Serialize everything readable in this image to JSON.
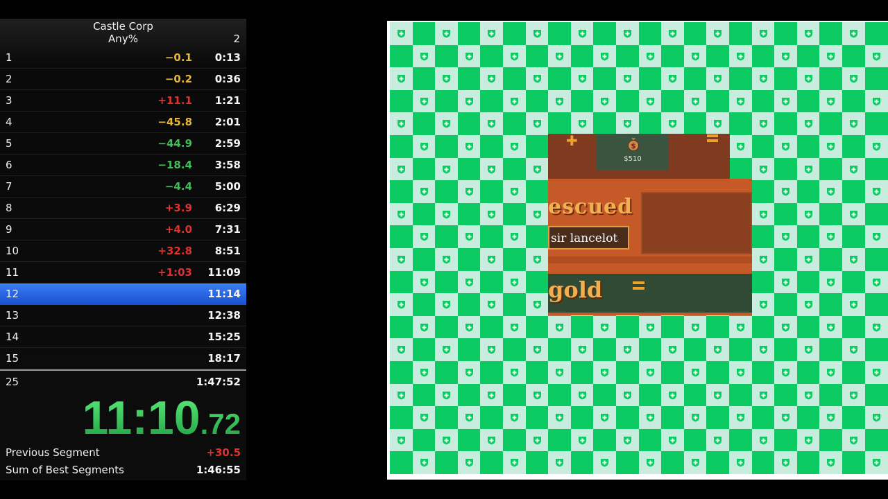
{
  "splits": {
    "game_name": "Castle Corp",
    "category": "Any%",
    "attempts": "2",
    "rows": [
      {
        "name": "1",
        "delta": "−0.1",
        "delta_color": "#e5b732",
        "time": "0:13"
      },
      {
        "name": "2",
        "delta": "−0.2",
        "delta_color": "#e5b732",
        "time": "0:36"
      },
      {
        "name": "3",
        "delta": "+11.1",
        "delta_color": "#e03030",
        "time": "1:21"
      },
      {
        "name": "4",
        "delta": "−45.8",
        "delta_color": "#e5b732",
        "time": "2:01"
      },
      {
        "name": "5",
        "delta": "−44.9",
        "delta_color": "#3fbf5a",
        "time": "2:59"
      },
      {
        "name": "6",
        "delta": "−18.4",
        "delta_color": "#3fbf5a",
        "time": "3:58"
      },
      {
        "name": "7",
        "delta": "−4.4",
        "delta_color": "#3fbf5a",
        "time": "5:00"
      },
      {
        "name": "8",
        "delta": "+3.9",
        "delta_color": "#e03030",
        "time": "6:29"
      },
      {
        "name": "9",
        "delta": "+4.0",
        "delta_color": "#e03030",
        "time": "7:31"
      },
      {
        "name": "10",
        "delta": "+32.8",
        "delta_color": "#e03030",
        "time": "8:51"
      },
      {
        "name": "11",
        "delta": "+1:03",
        "delta_color": "#e03030",
        "time": "11:09"
      },
      {
        "name": "12",
        "delta": "",
        "delta_color": "#ffffff",
        "time": "11:14",
        "current": true
      },
      {
        "name": "13",
        "delta": "",
        "delta_color": "#ffffff",
        "time": "12:38"
      },
      {
        "name": "14",
        "delta": "",
        "delta_color": "#ffffff",
        "time": "15:25"
      },
      {
        "name": "15",
        "delta": "",
        "delta_color": "#ffffff",
        "time": "18:17"
      }
    ],
    "final_split": {
      "name": "25",
      "time": "1:47:52"
    },
    "timer": {
      "main": "11:10",
      "fraction": ".72"
    },
    "previous_segment": {
      "label": "Previous Segment",
      "value": "+30.5",
      "color": "#e03030"
    },
    "sum_of_best": {
      "label": "Sum of Best Segments",
      "value": "1:46:55"
    }
  },
  "game": {
    "money": "$510",
    "rescued_text": "escued",
    "rescued_name": "sir lancelot",
    "gold_text": "gold",
    "colors": {
      "board_green": "#0ccb62",
      "board_light": "#c8ecde",
      "panel": "#c55a28"
    }
  }
}
